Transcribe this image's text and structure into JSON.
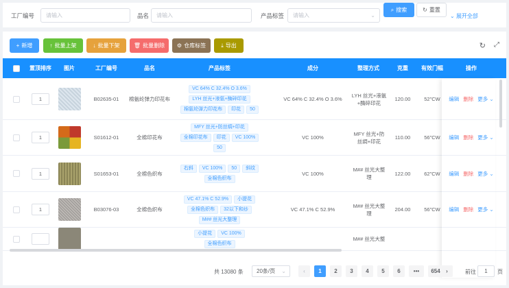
{
  "filters": {
    "factory_code_label": "工厂编号",
    "factory_code_placeholder": "请输入",
    "product_name_label": "品名",
    "product_name_placeholder": "请输入",
    "tags_label": "产品标签",
    "tags_placeholder": "请输入",
    "search": "搜索",
    "reset": "重置",
    "expand": "展开全部"
  },
  "toolbar": {
    "add": "新增",
    "batch_up": "批量上架",
    "batch_down": "批量下架",
    "batch_delete": "批量删除",
    "warehouse_tags": "仓库标签",
    "export": "导出"
  },
  "columns": [
    "置顶排序",
    "图片",
    "工厂编号",
    "品名",
    "产品标签",
    "成分",
    "整理方式",
    "克重",
    "有效门幅",
    "操作"
  ],
  "rows": [
    {
      "sort": "1",
      "code": "B02635-01",
      "name": "棉氨纶弹力印花布",
      "tags": [
        "VC 64% C 32.4% O 3.6%",
        "LYH 丝光+液氨+酶碎印花",
        "棉氨纶弹力印花布",
        "印花",
        "50"
      ],
      "composition": "VC 64% C 32.4% O 3.6%",
      "finish": "LYH 丝光+液氨+酶碎印花",
      "weight": "120.00",
      "width": "52\"CW"
    },
    {
      "sort": "1",
      "code": "S01612-01",
      "name": "全棉印花布",
      "tags": [
        "MFY 丝光+防丝绸+印花",
        "全棉印花布",
        "印花",
        "VC 100%",
        "50"
      ],
      "composition": "VC 100%",
      "finish": "MFY 丝光+防丝绸+印花",
      "weight": "110.00",
      "width": "56\"CW"
    },
    {
      "sort": "1",
      "code": "S01653-01",
      "name": "全棉色织布",
      "tags": [
        "右斜",
        "VC 100%",
        "50",
        "斜纹",
        "全棉色织布"
      ],
      "composition": "VC 100%",
      "finish": "M## 丝光大整理",
      "weight": "122.00",
      "width": "62\"CW"
    },
    {
      "sort": "1",
      "code": "B03076-03",
      "name": "全棉色织布",
      "tags": [
        "VC 47.1% C 52.9%",
        "小提花",
        "全棉色织布",
        "32以下和纱",
        "M## 丝光大整理"
      ],
      "composition": "VC 47.1% C 52.9%",
      "finish": "M## 丝光大整理",
      "weight": "204.00",
      "width": "56\"CW"
    },
    {
      "sort": "",
      "code": "",
      "name": "",
      "tags": [
        "小提花",
        "VC 100%",
        "全棉色织布"
      ],
      "composition": "",
      "finish": "M## 丝光大整",
      "weight": "",
      "width": ""
    }
  ],
  "ops": {
    "edit": "编辑",
    "delete": "删除",
    "more": "更多"
  },
  "pagination": {
    "total": "共 13080 条",
    "page_size": "20条/页",
    "pages": [
      "1",
      "2",
      "3",
      "4",
      "5",
      "6",
      "•••",
      "654"
    ],
    "goto": "前往",
    "goto_value": "1",
    "page_suffix": "页"
  },
  "colors": {
    "primary": "#409eff",
    "header": "#1890ff",
    "add": "#409eff",
    "up": "#67c23a",
    "down": "#e6a23c",
    "delete": "#f56c6c",
    "warehouse": "#8b7355",
    "export": "#a99a00"
  }
}
